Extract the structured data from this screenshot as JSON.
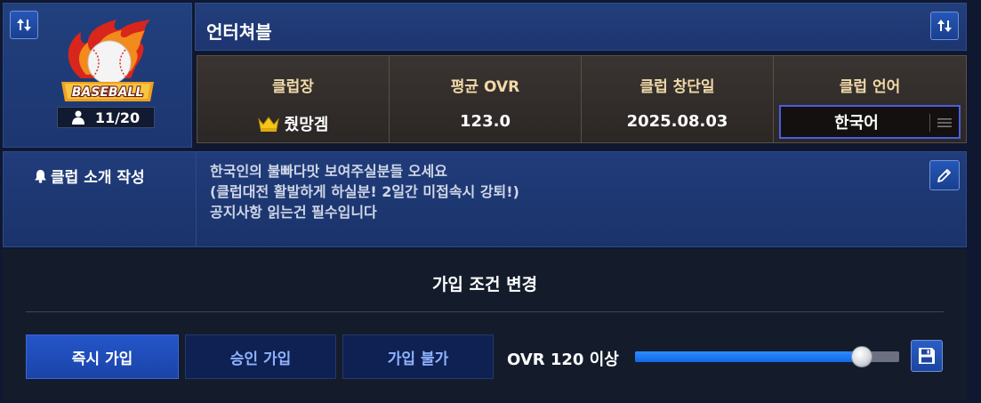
{
  "emblem": {
    "logo_text": "BASEBALL",
    "member_count": "11/20",
    "swap_icon": "up-down-arrows-icon"
  },
  "header": {
    "club_name": "언터쳐블",
    "swap_icon": "up-down-arrows-icon"
  },
  "info": {
    "leader": {
      "label": "클럽장",
      "value": "줬망겜",
      "icon": "crown-icon"
    },
    "avg_ovr": {
      "label": "평균 OVR",
      "value": "123.0"
    },
    "founded": {
      "label": "클럽 창단일",
      "value": "2025.08.03"
    },
    "language": {
      "label": "클럽 언어",
      "value": "한국어",
      "icon": "menu-icon"
    }
  },
  "intro": {
    "label": "클럽 소개 작성",
    "icon": "bell-icon",
    "lines": [
      "한국인의 불빠다맛 보여주실분들 오세요",
      "(클럽대전 활발하게 하실분! 2일간 미접속시 강퇴!)",
      "공지사항 읽는건 필수입니다"
    ],
    "edit_icon": "pencil-icon"
  },
  "join_condition": {
    "title": "가입 조건 변경",
    "buttons": [
      {
        "label": "즉시 가입",
        "selected": true
      },
      {
        "label": "승인 가입",
        "selected": false
      },
      {
        "label": "가입 불가",
        "selected": false
      }
    ],
    "ovr_label": "OVR 120 이상",
    "slider_level": 0.86,
    "save_icon": "save-icon"
  },
  "colors": {
    "panel_blue": "#1e3a76",
    "info_brown": "#332e2b",
    "header_gold": "#f1d9a8",
    "active_button": "#2455c9",
    "slider_fill": "#1d7cf5",
    "background": "#141c2c"
  }
}
